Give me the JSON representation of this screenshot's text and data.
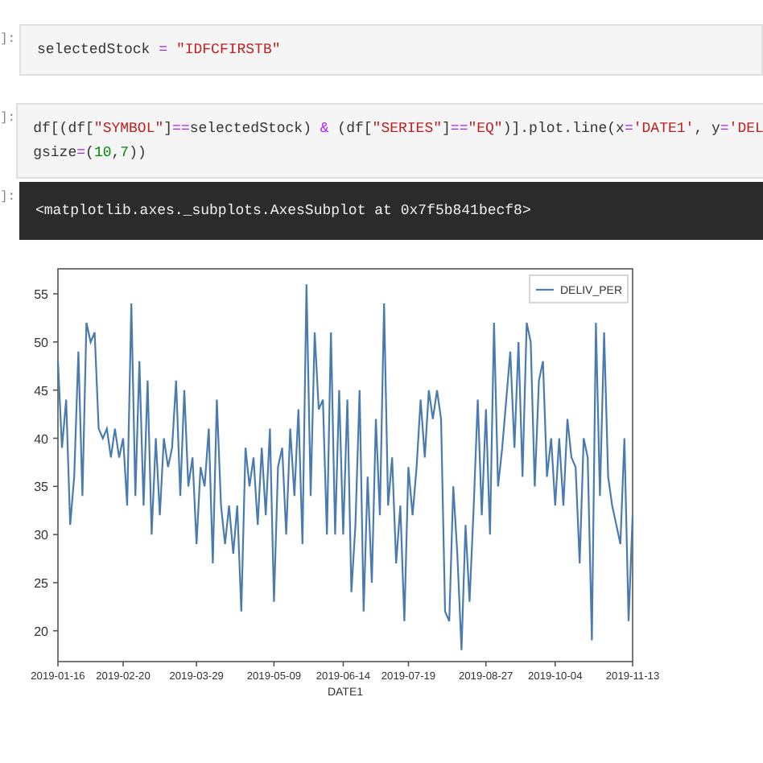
{
  "cells": [
    {
      "prompt": "]:",
      "kind": "code",
      "lines": [
        [
          {
            "kind": "plain",
            "text": "selectedStock "
          },
          {
            "kind": "operator",
            "text": "= "
          },
          {
            "kind": "string",
            "text": "\"IDFCFIRSTB\""
          }
        ]
      ]
    },
    {
      "prompt": "]:",
      "kind": "code",
      "lines": [
        [
          {
            "kind": "plain",
            "text": "df[(df["
          },
          {
            "kind": "string",
            "text": "\"SYMBOL\""
          },
          {
            "kind": "plain",
            "text": "]"
          },
          {
            "kind": "operator",
            "text": "=="
          },
          {
            "kind": "plain",
            "text": "selectedStock) "
          },
          {
            "kind": "operator",
            "text": "&"
          },
          {
            "kind": "plain",
            "text": " (df["
          },
          {
            "kind": "string",
            "text": "\"SERIES\""
          },
          {
            "kind": "plain",
            "text": "]"
          },
          {
            "kind": "operator",
            "text": "=="
          },
          {
            "kind": "string",
            "text": "\"EQ\""
          },
          {
            "kind": "plain",
            "text": ")].plot.line(x"
          },
          {
            "kind": "operator",
            "text": "="
          },
          {
            "kind": "string",
            "text": "'DATE1'"
          },
          {
            "kind": "plain",
            "text": ", y"
          },
          {
            "kind": "operator",
            "text": "="
          },
          {
            "kind": "string",
            "text": "'DEL"
          }
        ],
        [
          {
            "kind": "plain",
            "text": "gsize"
          },
          {
            "kind": "operator",
            "text": "="
          },
          {
            "kind": "plain",
            "text": "("
          },
          {
            "kind": "number",
            "text": "10"
          },
          {
            "kind": "plain",
            "text": ","
          },
          {
            "kind": "number",
            "text": "7"
          },
          {
            "kind": "plain",
            "text": "))"
          }
        ]
      ]
    },
    {
      "prompt": "]:",
      "kind": "output",
      "text": "<matplotlib.axes._subplots.AxesSubplot at 0x7f5b841becf8>"
    }
  ],
  "chart_data": {
    "type": "line",
    "xlabel": "DATE1",
    "ylim": [
      16.8,
      57.6
    ],
    "categories": [
      "2019-01-16",
      null,
      null,
      null,
      null,
      null,
      null,
      null,
      null,
      null,
      null,
      null,
      null,
      null,
      null,
      null,
      "2019-02-20",
      null,
      null,
      null,
      null,
      null,
      null,
      null,
      null,
      null,
      null,
      null,
      null,
      null,
      null,
      null,
      null,
      null,
      "2019-03-29",
      null,
      null,
      null,
      null,
      null,
      null,
      null,
      null,
      null,
      null,
      null,
      null,
      null,
      null,
      null,
      null,
      null,
      null,
      "2019-05-09",
      null,
      null,
      null,
      null,
      null,
      null,
      null,
      null,
      null,
      null,
      null,
      null,
      null,
      null,
      null,
      null,
      "2019-06-14",
      null,
      null,
      null,
      null,
      null,
      null,
      null,
      null,
      null,
      null,
      null,
      null,
      null,
      null,
      null,
      "2019-07-19",
      null,
      null,
      null,
      null,
      null,
      null,
      null,
      null,
      null,
      null,
      null,
      null,
      null,
      null,
      null,
      null,
      null,
      null,
      "2019-08-27",
      null,
      null,
      null,
      null,
      null,
      null,
      null,
      null,
      null,
      null,
      null,
      null,
      null,
      null,
      null,
      null,
      "2019-10-04",
      null,
      null,
      null,
      null,
      null,
      null,
      null,
      null,
      null,
      null,
      null,
      null,
      null,
      null,
      null,
      null,
      null,
      null,
      "2019-11-13"
    ],
    "yticks": [
      20,
      25,
      30,
      35,
      40,
      45,
      50,
      55
    ],
    "series": [
      {
        "name": "DELIV_PER",
        "color": "#4a7bb0",
        "values": [
          48,
          39,
          44,
          31,
          36,
          49,
          34,
          52,
          50,
          51,
          41,
          40,
          41,
          38,
          41,
          38,
          40,
          33,
          54,
          34,
          48,
          33,
          46,
          30,
          40,
          32,
          40,
          37,
          39,
          46,
          34,
          45,
          35,
          38,
          29,
          37,
          35,
          41,
          27,
          44,
          33,
          29,
          33,
          28,
          33,
          22,
          39,
          35,
          38,
          31,
          39,
          32,
          41,
          23,
          37,
          39,
          30,
          41,
          34,
          43,
          29,
          56,
          34,
          51,
          43,
          44,
          30,
          51,
          30,
          45,
          30,
          44,
          24,
          31,
          45,
          22,
          36,
          25,
          42,
          32,
          54,
          33,
          38,
          27,
          33,
          21,
          37,
          32,
          37,
          44,
          38,
          45,
          42,
          45,
          42,
          22,
          21,
          35,
          28,
          18,
          31,
          23,
          33,
          44,
          32,
          43,
          30,
          52,
          35,
          39,
          44,
          49,
          39,
          50,
          36,
          52,
          50,
          35,
          46,
          48,
          36,
          40,
          33,
          40,
          33,
          42,
          38,
          37,
          27,
          40,
          38,
          19,
          52,
          34,
          51,
          36,
          33,
          31,
          29,
          40,
          21,
          32
        ]
      }
    ]
  }
}
